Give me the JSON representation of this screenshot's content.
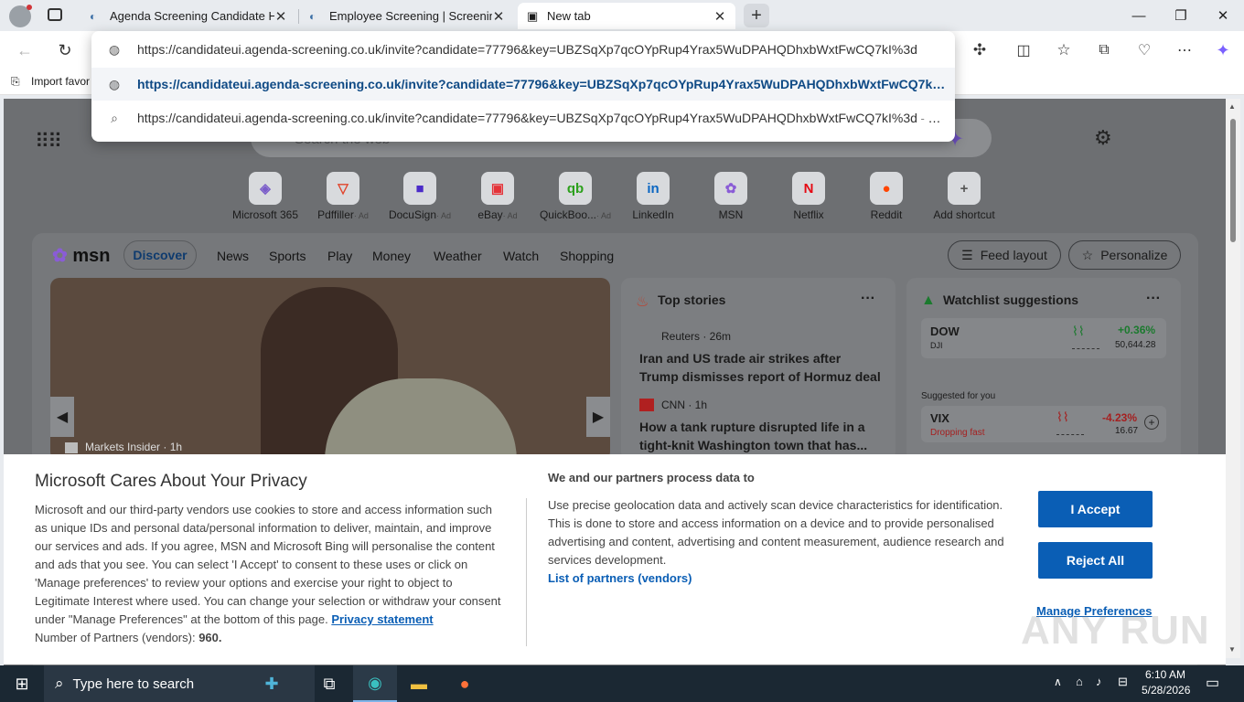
{
  "browser": {
    "tabs": [
      {
        "label": "Agenda Screening Candidate Hub"
      },
      {
        "label": "Employee Screening | Screening S"
      },
      {
        "label": "New tab"
      }
    ],
    "address_value": "https://candidateui.agenda-screening.co.uk/invite?candidate=77796&key=UBZSqXp7qcOYpRup4Yrax5WuDPAHQDhxbWxtFwCQ7kI%3d",
    "suggestions": [
      {
        "text": "https://candidateui.agenda-screening.co.uk/invite?candidate=77796&key=UBZSqXp7qcOYpRup4Yrax5WuDPAHQDhxbWxtFwCQ7kI...",
        "suffix": ""
      },
      {
        "text": "https://candidateui.agenda-screening.co.uk/invite?candidate=77796&key=UBZSqXp7qcOYpRup4Yrax5WuDPAHQDhxbWxtFwCQ7kI%3d",
        "suffix": " - Bin..."
      }
    ],
    "favorites_label": "Import favor"
  },
  "newtab": {
    "search_placeholder": "Search the web",
    "quick_links": [
      {
        "label": "Microsoft 365",
        "ad": "",
        "glyph": "◈",
        "color": "#7a5cc9"
      },
      {
        "label": "Pdffiller",
        "ad": "· Ad",
        "glyph": "▽",
        "color": "#e1452c"
      },
      {
        "label": "DocuSign",
        "ad": "· Ad",
        "glyph": "■",
        "color": "#4b2bc8"
      },
      {
        "label": "eBay",
        "ad": "· Ad",
        "glyph": "▣",
        "color": "#e53238"
      },
      {
        "label": "QuickBoo...",
        "ad": "· Ad",
        "glyph": "qb",
        "color": "#2ca01c"
      },
      {
        "label": "LinkedIn",
        "ad": "",
        "glyph": "in",
        "color": "#0a66c2"
      },
      {
        "label": "MSN",
        "ad": "",
        "glyph": "✿",
        "color": "#8a5cd6"
      },
      {
        "label": "Netflix",
        "ad": "",
        "glyph": "N",
        "color": "#e50914"
      },
      {
        "label": "Reddit",
        "ad": "",
        "glyph": "●",
        "color": "#ff4500"
      },
      {
        "label": "Add shortcut",
        "ad": "",
        "glyph": "+",
        "color": "#555555"
      }
    ],
    "msn_logo": "msn",
    "nav": [
      "Discover",
      "News",
      "Sports",
      "Play",
      "Money",
      "Weather",
      "Watch",
      "Shopping"
    ],
    "feed_layout": "Feed layout",
    "personalize": "Personalize",
    "hero_source": "Markets Insider · 1h",
    "top_stories": {
      "title": "Top stories",
      "items": [
        {
          "source": "Reuters · 26m",
          "headline": "Iran and US trade air strikes after Trump dismisses report of Hormuz deal"
        },
        {
          "source": "CNN · 1h",
          "headline": "How a tank rupture disrupted life in a tight-knit Washington town that has..."
        }
      ]
    },
    "watchlist": {
      "title": "Watchlist suggestions",
      "items": [
        {
          "symbol": "DOW",
          "sub": "DJI",
          "change": "+0.36%",
          "value": "50,644.28",
          "color": "#1b7a2e"
        },
        {
          "symbol": "VIX",
          "sub": "Dropping fast",
          "change": "-4.23%",
          "value": "16.67",
          "color": "#c72b2b"
        }
      ],
      "suggested": "Suggested for you"
    }
  },
  "consent": {
    "title": "Microsoft Cares About Your Privacy",
    "body": "Microsoft and our third-party vendors use cookies to store and access information such as unique IDs and personal data/personal information to deliver, maintain, and improve our services and ads. If you agree, MSN and Microsoft Bing will personalise the content and ads that you see. You can select 'I Accept' to consent to these uses or click on 'Manage preferences' to review your options and exercise your right to object to Legitimate Interest where used. You can change your selection or withdraw your consent under \"Manage Preferences\" at the bottom of this page.",
    "privacy_link": "Privacy statement",
    "partners_label": "Number of Partners (vendors):",
    "partners_count": "960.",
    "right_title": "We and our partners process data to",
    "right_body": "Use precise geolocation data and actively scan device characteristics for identification. This is done to store and access information on a device and to provide personalised advertising and content, advertising and content measurement, audience research and services development.",
    "vendors_link": "List of partners (vendors)",
    "accept": "I Accept",
    "reject": "Reject All",
    "manage": "Manage Preferences"
  },
  "taskbar": {
    "search_placeholder": "Type here to search",
    "time": "6:10 AM",
    "date": "5/28/2026"
  },
  "watermark": "ANY RUN"
}
